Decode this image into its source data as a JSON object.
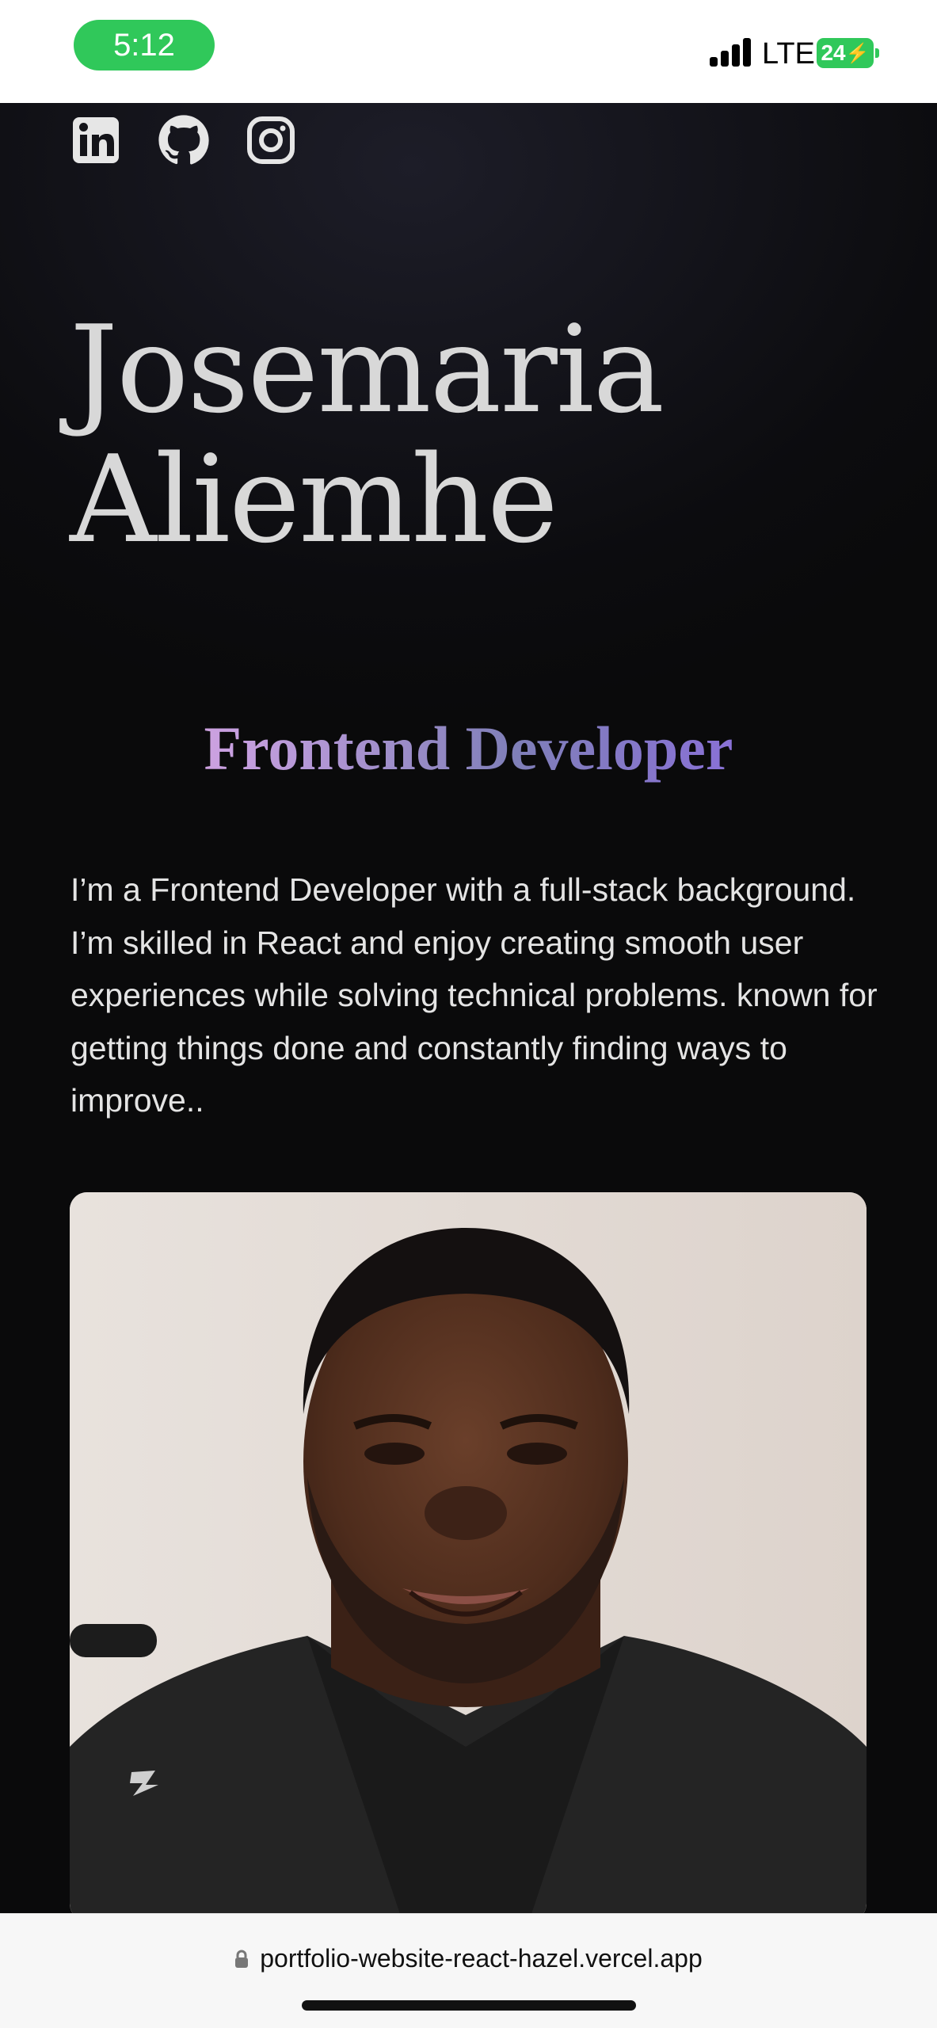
{
  "status_bar": {
    "time": "5:12",
    "network": "LTE",
    "battery": "24"
  },
  "social_links": [
    {
      "name": "linkedin-icon"
    },
    {
      "name": "github-icon"
    },
    {
      "name": "instagram-icon"
    }
  ],
  "hero": {
    "name_line1": "Josemaria",
    "name_line2": "Aliemhe",
    "role": "Frontend Developer",
    "bio": "I’m a Frontend Developer with a full-stack background. I’m skilled in React and enjoy creating smooth user experiences while solving technical problems. known for getting things done and constantly finding ways to improve.."
  },
  "browser": {
    "url": "portfolio-website-react-hazel.vercel.app"
  },
  "colors": {
    "status_green": "#30c85a",
    "background": "#0b0b0d",
    "text_light": "#e4e4e4",
    "gradient_start": "#f0a8d8",
    "gradient_end": "#a85be8"
  }
}
